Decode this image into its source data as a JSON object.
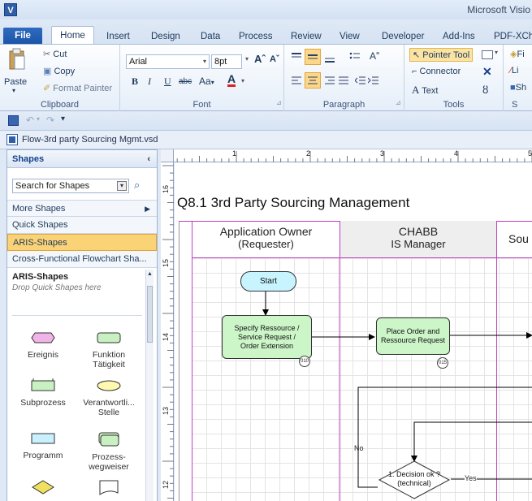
{
  "window": {
    "app_initial": "V",
    "title": "Microsoft Visio"
  },
  "tabs": [
    "File",
    "Home",
    "Insert",
    "Design",
    "Data",
    "Process",
    "Review",
    "View",
    "Developer",
    "Add-Ins",
    "PDF-XCha"
  ],
  "ribbon": {
    "clipboard": {
      "paste": "Paste",
      "cut": "Cut",
      "copy": "Copy",
      "format_painter": "Format Painter",
      "label": "Clipboard"
    },
    "font": {
      "family": "Arial",
      "size": "8pt",
      "label": "Font",
      "aa_label": "Aa"
    },
    "paragraph": {
      "label": "Paragraph"
    },
    "tools": {
      "pointer": "Pointer Tool",
      "connector": "Connector",
      "text": "Text",
      "label": "Tools"
    },
    "shape": {
      "fill": "Fi",
      "line": "Li",
      "shadow": "Sh",
      "label": "S"
    }
  },
  "document": {
    "tab_title": "Flow-3rd party Sourcing Mgmt.vsd"
  },
  "shapes_panel": {
    "title": "Shapes",
    "search_placeholder": "Search for Shapes",
    "more_shapes": "More Shapes",
    "rows": [
      "Quick Shapes",
      "ARIS-Shapes",
      "Cross-Functional Flowchart Sha..."
    ],
    "selected_index": 1,
    "stencil_title": "ARIS-Shapes",
    "stencil_hint": "Drop Quick Shapes here",
    "masters": [
      {
        "name": "Ereignis",
        "icon": "event-hexagon-icon",
        "color": "#f0b4e8"
      },
      {
        "name": "Funktion\nTätigkeit",
        "icon": "function-rect-icon",
        "color": "#c8f0c0"
      },
      {
        "name": "Subprozess",
        "icon": "subprocess-icon",
        "color": "#c8f0c0"
      },
      {
        "name": "Verantwortli...\nStelle",
        "icon": "responsible-ellipse-icon",
        "color": "#fff8b0"
      },
      {
        "name": "Programm",
        "icon": "program-rect-icon",
        "color": "#c8f0ff"
      },
      {
        "name": "Prozess-\nwegweiser",
        "icon": "process-pointer-icon",
        "color": "#c8f0c0"
      },
      {
        "name": "",
        "icon": "decision-diamond-icon",
        "color": "#f0e060"
      },
      {
        "name": "",
        "icon": "document-icon",
        "color": "#ffffff"
      }
    ]
  },
  "rulers": {
    "h": [
      "1",
      "2",
      "3",
      "4",
      "5"
    ],
    "v": [
      "16",
      "15",
      "14",
      "13",
      "12"
    ]
  },
  "diagram": {
    "title": "Q8.1 3rd Party Sourcing Management",
    "lanes": [
      {
        "line1": "Application Owner",
        "line2": "(Requester)"
      },
      {
        "line1": "CHABB",
        "line2": "IS Manager"
      },
      {
        "line1": "Sou",
        "line2": ""
      }
    ],
    "start": "Start",
    "task1": "Specify Ressource /\nService Request /\nOrder Extension",
    "task1_id": "010",
    "task2": "Place Order and\nRessource Request",
    "task2_id": "015",
    "decision": "1. Decision ok ?\n(technical)",
    "no_label": "No",
    "yes_label": "Yes"
  }
}
